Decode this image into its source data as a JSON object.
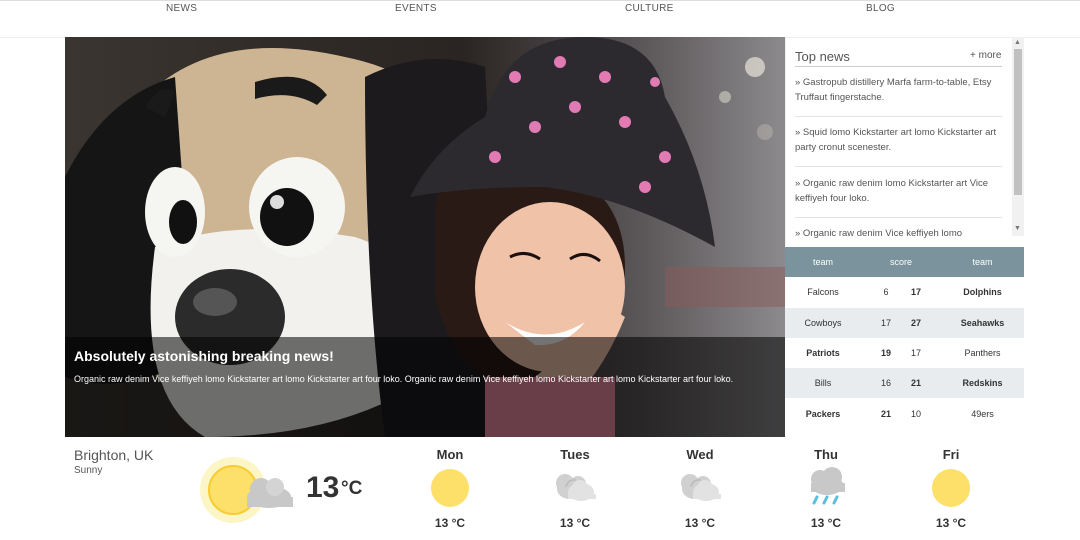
{
  "nav": {
    "items": [
      {
        "label": "NEWS"
      },
      {
        "label": "EVENTS"
      },
      {
        "label": "CULTURE"
      },
      {
        "label": "BLOG"
      }
    ]
  },
  "hero": {
    "title": "Absolutely astonishing breaking news!",
    "text": "Organic raw denim Vice keffiyeh lomo Kickstarter art lomo Kickstarter art four loko. Organic raw denim Vice keffiyeh lomo Kickstarter art lomo Kickstarter art four loko."
  },
  "top_news": {
    "title": "Top news",
    "more": "+ more",
    "items": [
      {
        "text": "» Gastropub distillery Marfa farm-to-table, Etsy Truffaut fingerstache."
      },
      {
        "text": "» Squid lomo Kickstarter art lomo Kickstarter art party cronut scenester."
      },
      {
        "text": "» Organic raw denim lomo Kickstarter art Vice keffiyeh four loko."
      },
      {
        "text": "» Organic raw denim Vice keffiyeh lomo"
      }
    ]
  },
  "scores": {
    "headers": {
      "team1": "team",
      "score": "score",
      "team2": "team"
    },
    "rows": [
      {
        "team1": "Falcons",
        "score1": "6",
        "score2": "17",
        "team2": "Dolphins",
        "winner": 2
      },
      {
        "team1": "Cowboys",
        "score1": "17",
        "score2": "27",
        "team2": "Seahawks",
        "winner": 2
      },
      {
        "team1": "Patriots",
        "score1": "19",
        "score2": "17",
        "team2": "Panthers",
        "winner": 1
      },
      {
        "team1": "Bills",
        "score1": "16",
        "score2": "21",
        "team2": "Redskins",
        "winner": 2
      },
      {
        "team1": "Packers",
        "score1": "21",
        "score2": "10",
        "team2": "49ers",
        "winner": 1
      }
    ]
  },
  "weather": {
    "city": "Brighton, UK",
    "condition": "Sunny",
    "icon": "sun-cloud-icon",
    "temp": "13",
    "unit": "°C",
    "forecast": [
      {
        "day": "Mon",
        "icon": "sun-icon",
        "temp": "13 °C"
      },
      {
        "day": "Tues",
        "icon": "cloud-icon",
        "temp": "13 °C"
      },
      {
        "day": "Wed",
        "icon": "cloud-icon",
        "temp": "13 °C"
      },
      {
        "day": "Thu",
        "icon": "rain-icon",
        "temp": "13 °C"
      },
      {
        "day": "Fri",
        "icon": "sun-icon",
        "temp": "13 °C"
      }
    ]
  },
  "colors": {
    "score_header": "#7a939c",
    "sun": "#fde06a",
    "cloud": "#c8c8c8",
    "rain": "#5bc0de"
  }
}
